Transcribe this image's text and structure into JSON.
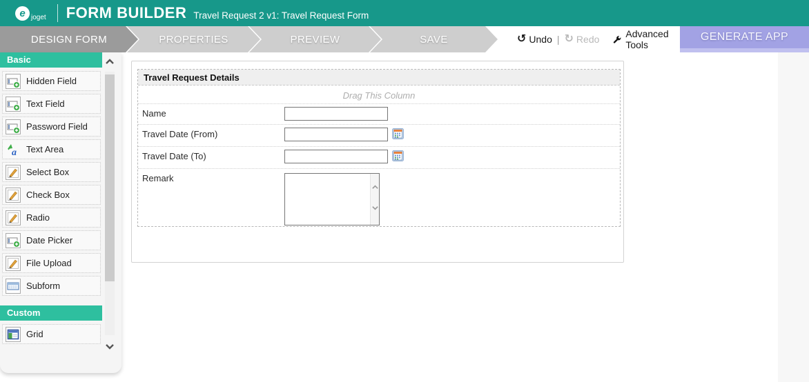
{
  "header": {
    "brand": "joget",
    "logo_letter": "e",
    "title": "FORM BUILDER",
    "subtitle": "Travel Request 2 v1: Travel Request Form"
  },
  "nav": {
    "tabs": [
      {
        "label": "DESIGN FORM",
        "active": true
      },
      {
        "label": "PROPERTIES",
        "active": false
      },
      {
        "label": "PREVIEW",
        "active": false
      },
      {
        "label": "SAVE",
        "active": false
      }
    ],
    "undo_label": "Undo",
    "redo_label": "Redo",
    "separator": "|",
    "advanced_tools_label": "Advanced Tools",
    "generate_app_label": "GENERATE APP"
  },
  "palette": {
    "sections": [
      {
        "title": "Basic",
        "items": [
          {
            "label": "Hidden Field",
            "icon": "input-add-icon"
          },
          {
            "label": "Text Field",
            "icon": "input-add-icon"
          },
          {
            "label": "Password Field",
            "icon": "input-add-icon"
          },
          {
            "label": "Text Area",
            "icon": "textarea-icon"
          },
          {
            "label": "Select Box",
            "icon": "pencil-box-icon"
          },
          {
            "label": "Check Box",
            "icon": "pencil-box-icon"
          },
          {
            "label": "Radio",
            "icon": "pencil-box-icon"
          },
          {
            "label": "Date Picker",
            "icon": "input-add-icon"
          },
          {
            "label": "File Upload",
            "icon": "pencil-box-icon"
          },
          {
            "label": "Subform",
            "icon": "subform-icon"
          }
        ]
      },
      {
        "title": "Custom",
        "items": [
          {
            "label": "Grid",
            "icon": "grid-icon"
          }
        ]
      }
    ]
  },
  "form": {
    "section_title": "Travel Request Details",
    "drag_hint": "Drag This Column",
    "fields": [
      {
        "label": "Name",
        "type": "text",
        "value": ""
      },
      {
        "label": "Travel Date (From)",
        "type": "date",
        "value": ""
      },
      {
        "label": "Travel Date (To)",
        "type": "date",
        "value": ""
      },
      {
        "label": "Remark",
        "type": "textarea",
        "value": ""
      }
    ]
  },
  "colors": {
    "header_teal": "#17988a",
    "palette_teal": "#2ebf9f",
    "active_tab_gray": "#9b9b9b",
    "inactive_tab_gray": "#cecece",
    "generate_app_purple": "#a2a2e4"
  }
}
